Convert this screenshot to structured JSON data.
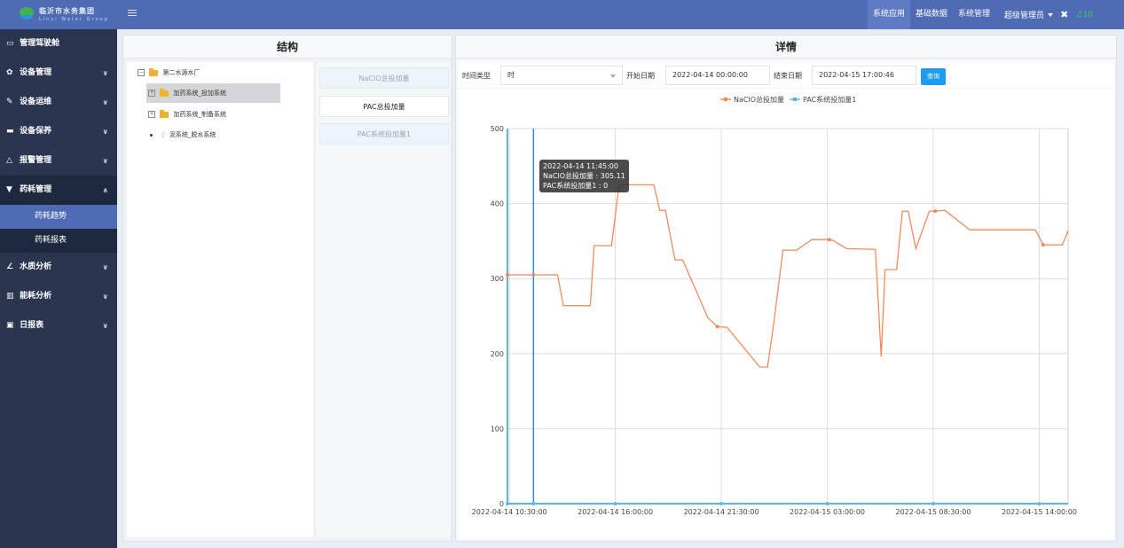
{
  "header": {
    "logo_cn": "临沂市水务集团",
    "logo_en": "Linyi Water Group",
    "nav": [
      "系统应用",
      "基础数据",
      "系统管理"
    ],
    "user": "超级管理员",
    "notification_count": "10"
  },
  "sidebar": {
    "items": [
      {
        "label": "管理驾驶舱",
        "icon": "monitor-icon"
      },
      {
        "label": "设备管理",
        "icon": "gear-icon"
      },
      {
        "label": "设备运维",
        "icon": "wrench-icon"
      },
      {
        "label": "设备保养",
        "icon": "toolbox-icon"
      },
      {
        "label": "报警管理",
        "icon": "bell-icon"
      },
      {
        "label": "药耗管理",
        "icon": "filter-icon"
      },
      {
        "label": "水质分析",
        "icon": "line-chart-icon"
      },
      {
        "label": "能耗分析",
        "icon": "bar-chart-icon"
      },
      {
        "label": "日报表",
        "icon": "report-icon"
      }
    ],
    "sub_items": [
      "药耗趋势",
      "药耗报表"
    ]
  },
  "structure": {
    "title": "结构",
    "tree": {
      "root": "第二水源水厂",
      "children": [
        "加药系统_投加系统",
        "加药系统_制备系统",
        "泥系统_脱水系统"
      ]
    },
    "metrics": [
      "NaClO总投加量",
      "PAC总投加量",
      "PAC系统投加量1"
    ]
  },
  "detail": {
    "title": "详情",
    "time_type_label": "时间类型",
    "time_type_value": "时",
    "start_label": "开始日期",
    "start_value": "2022-04-14 00:00:00",
    "end_label": "结束日期",
    "end_value": "2022-04-15 17:00:46",
    "query_button": "查询"
  },
  "tooltip": {
    "time": "2022-04-14 11:45:00",
    "line1": "NaClO总投加量 : 305.11",
    "line2": "PAC系统投加量1 : 0"
  },
  "chart_data": {
    "type": "line",
    "ylim": [
      0,
      500
    ],
    "yticks": [
      "0",
      "100",
      "200",
      "300",
      "400",
      "500"
    ],
    "xticks": [
      "2022-04-14 10:30:00",
      "2022-04-14 16:00:00",
      "2022-04-14 21:30:00",
      "2022-04-15 03:00:00",
      "2022-04-15 08:30:00",
      "2022-04-15 14:00:00"
    ],
    "xtick_hours": [
      10.5,
      16,
      21.5,
      27,
      32.5,
      38
    ],
    "xlim_hours": [
      10.4,
      39.5
    ],
    "grid": true,
    "legend_position": "top-center",
    "colors": {
      "naclo": "#f08a5d",
      "pac": "#5cb6e8"
    },
    "series": [
      {
        "name": "NaClO总投加量",
        "x_hours": [
          10.4,
          11.75,
          12.5,
          13.0,
          13.3,
          14.5,
          14.7,
          14.9,
          15.8,
          16.2,
          18.0,
          18.3,
          18.6,
          19.1,
          19.3,
          19.5,
          20.8,
          21.3,
          21.8,
          23.5,
          23.9,
          24.2,
          24.7,
          25.4,
          26.2,
          26.4,
          27.1,
          27.3,
          28.0,
          29.5,
          29.8,
          30.0,
          30.6,
          30.9,
          31.2,
          31.6,
          32.3,
          32.6,
          33.1,
          34.4,
          35.0,
          37.8,
          38.2,
          39.2,
          39.5
        ],
        "values": [
          305,
          305,
          305,
          305,
          264,
          264,
          264,
          344,
          344,
          425,
          425,
          391,
          391,
          325,
          325,
          325,
          248,
          236,
          235,
          182,
          182,
          236,
          338,
          338,
          352,
          352,
          352,
          351,
          340,
          339,
          196,
          312,
          312,
          390,
          390,
          340,
          390,
          390,
          391,
          365,
          365,
          365,
          345,
          345,
          364
        ]
      },
      {
        "name": "PAC系统投加量1",
        "x_hours": [
          10.4,
          39.5
        ],
        "values": [
          0,
          0
        ]
      }
    ]
  }
}
